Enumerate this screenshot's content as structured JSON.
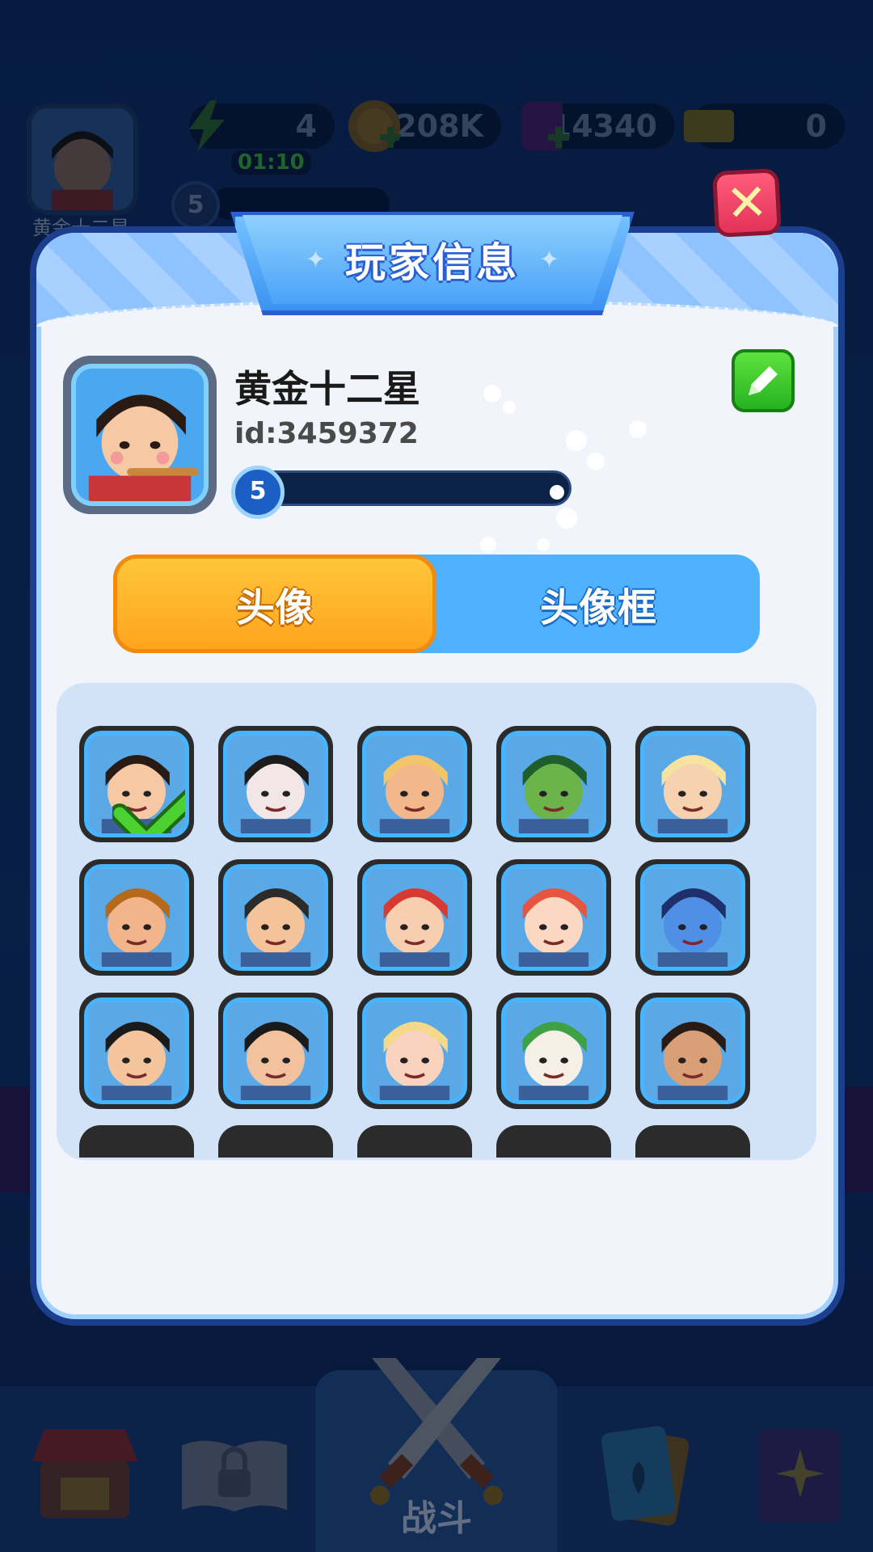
{
  "hud": {
    "player_name": "黄金十二星",
    "energy": "4",
    "energy_timer": "01:10",
    "coins": "208K",
    "gems": "14340",
    "tickets": "0",
    "level": "5"
  },
  "modal": {
    "title": "玩家信息",
    "player_name": "黄金十二星",
    "player_id": "id:3459372",
    "level": "5",
    "xp_progress": 0.05
  },
  "tabs": {
    "avatar": "头像",
    "avatar_frame": "头像框",
    "active": "avatar"
  },
  "avatars": [
    {
      "name": "warrior-girl",
      "bg": "#5aa9e6",
      "skin": "#f6c9a4",
      "hair": "#2a1a14",
      "selected": true
    },
    {
      "name": "opera-general",
      "bg": "#5aa9e6",
      "skin": "#f3e6e6",
      "hair": "#1c1c1c",
      "selected": false
    },
    {
      "name": "blond-soldier",
      "bg": "#5aa9e6",
      "skin": "#f2b88b",
      "hair": "#f3c56b",
      "selected": false
    },
    {
      "name": "green-brute",
      "bg": "#5aa9e6",
      "skin": "#6db34b",
      "hair": "#1f5d2a",
      "selected": false
    },
    {
      "name": "blond-prince",
      "bg": "#5aa9e6",
      "skin": "#f7d2b0",
      "hair": "#f6e3a0",
      "selected": false
    },
    {
      "name": "bearded-king",
      "bg": "#5aa9e6",
      "skin": "#f2b48a",
      "hair": "#b4691b",
      "selected": false
    },
    {
      "name": "fortune-god",
      "bg": "#5aa9e6",
      "skin": "#f4c39a",
      "hair": "#2b2b2b",
      "selected": false
    },
    {
      "name": "red-hood",
      "bg": "#5aa9e6",
      "skin": "#f7cfb0",
      "hair": "#d83a32",
      "selected": false
    },
    {
      "name": "mermaid",
      "bg": "#5aa9e6",
      "skin": "#fbd8c2",
      "hair": "#e6553f",
      "selected": false
    },
    {
      "name": "blue-genie",
      "bg": "#5aa9e6",
      "skin": "#4f8fe6",
      "hair": "#1f2f6b",
      "selected": false
    },
    {
      "name": "egypt-queen",
      "bg": "#5aa9e6",
      "skin": "#f4c49c",
      "hair": "#1a1a1a",
      "selected": false
    },
    {
      "name": "glasses-boy",
      "bg": "#5aa9e6",
      "skin": "#f2c29f",
      "hair": "#1a1a1a",
      "selected": false
    },
    {
      "name": "blond-goddess",
      "bg": "#5aa9e6",
      "skin": "#fad3be",
      "hair": "#f4d98a",
      "selected": false
    },
    {
      "name": "joker",
      "bg": "#5aa9e6",
      "skin": "#f6efe6",
      "hair": "#3ea146",
      "selected": false
    },
    {
      "name": "pirate",
      "bg": "#5aa9e6",
      "skin": "#d9a077",
      "hair": "#2a1a14",
      "selected": false
    }
  ],
  "bottom_nav": {
    "battle": "战斗"
  },
  "colors": {
    "tab_active": "#ffb22b",
    "tab_inactive": "#4fb2ff",
    "edit_button": "#36c72a",
    "close_button": "#f24467"
  }
}
